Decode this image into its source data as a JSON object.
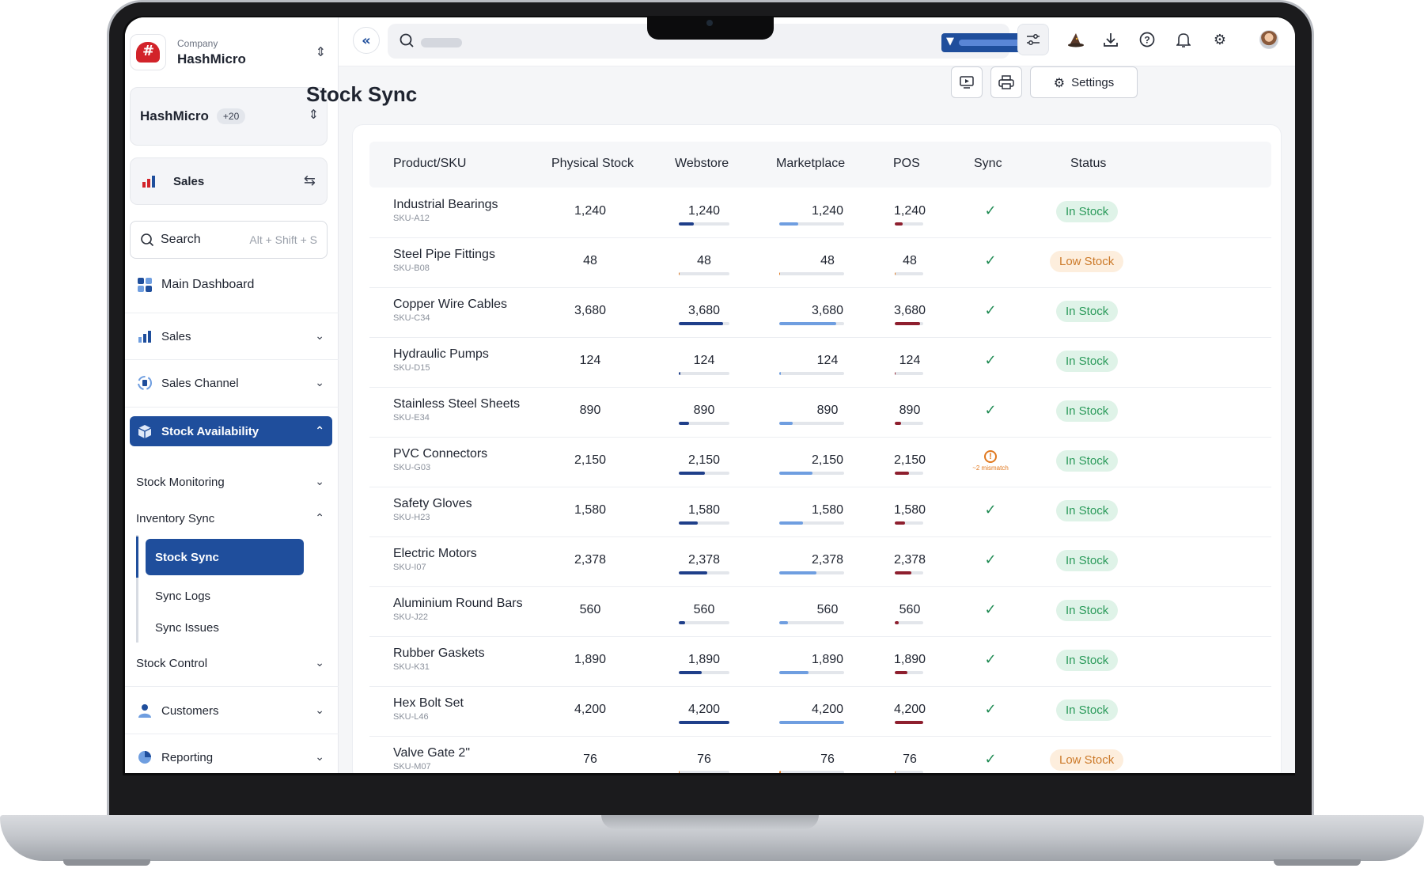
{
  "app": {
    "company_label": "Company",
    "company_name": "HashMicro",
    "switcher_name": "HashMicro",
    "switcher_count": "+20",
    "module_label": "Sales"
  },
  "sidebar": {
    "search_text": "Search",
    "search_hint": "Alt + Shift + S",
    "dashboard": "Main Dashboard",
    "sales": "Sales",
    "sales_channel": "Sales Channel",
    "stock_availability": "Stock Availability",
    "stock_monitoring": "Stock Monitoring",
    "inventory_sync": "Inventory Sync",
    "stock_sync": "Stock Sync",
    "sync_logs": "Sync Logs",
    "sync_issues": "Sync Issues",
    "stock_control": "Stock Control",
    "customers": "Customers",
    "reporting": "Reporting"
  },
  "header": {
    "title": "Stock Sync",
    "settings_label": "Settings"
  },
  "table": {
    "columns": [
      "Product/SKU",
      "Physical Stock",
      "Webstore",
      "Marketplace",
      "POS",
      "Sync",
      "Status"
    ],
    "rows": [
      {
        "name": "Industrial Bearings",
        "sku": "SKU-A12",
        "physical": "1,240",
        "webstore": "1,240",
        "marketplace": "1,240",
        "pos": "1,240",
        "level": 0.29,
        "sync": "ok",
        "status": "In Stock"
      },
      {
        "name": "Steel Pipe Fittings",
        "sku": "SKU-B08",
        "physical": "48",
        "webstore": "48",
        "marketplace": "48",
        "pos": "48",
        "level": 0.01,
        "sync": "ok",
        "status": "Low Stock"
      },
      {
        "name": "Copper Wire Cables",
        "sku": "SKU-C34",
        "physical": "3,680",
        "webstore": "3,680",
        "marketplace": "3,680",
        "pos": "3,680",
        "level": 0.88,
        "sync": "ok",
        "status": "In Stock"
      },
      {
        "name": "Hydraulic Pumps",
        "sku": "SKU-D15",
        "physical": "124",
        "webstore": "124",
        "marketplace": "124",
        "pos": "124",
        "level": 0.03,
        "sync": "ok",
        "status": "In Stock"
      },
      {
        "name": "Stainless Steel Sheets",
        "sku": "SKU-E34",
        "physical": "890",
        "webstore": "890",
        "marketplace": "890",
        "pos": "890",
        "level": 0.21,
        "sync": "ok",
        "status": "In Stock"
      },
      {
        "name": "PVC Connectors",
        "sku": "SKU-G03",
        "physical": "2,150",
        "webstore": "2,150",
        "marketplace": "2,150",
        "pos": "2,150",
        "level": 0.51,
        "sync": "warn",
        "sync_note": "~2 mismatch",
        "status": "In Stock"
      },
      {
        "name": "Safety Gloves",
        "sku": "SKU-H23",
        "physical": "1,580",
        "webstore": "1,580",
        "marketplace": "1,580",
        "pos": "1,580",
        "level": 0.37,
        "sync": "ok",
        "status": "In Stock"
      },
      {
        "name": "Electric Motors",
        "sku": "SKU-I07",
        "physical": "2,378",
        "webstore": "2,378",
        "marketplace": "2,378",
        "pos": "2,378",
        "level": 0.57,
        "sync": "ok",
        "status": "In Stock"
      },
      {
        "name": "Aluminium Round Bars",
        "sku": "SKU-J22",
        "physical": "560",
        "webstore": "560",
        "marketplace": "560",
        "pos": "560",
        "level": 0.13,
        "sync": "ok",
        "status": "In Stock"
      },
      {
        "name": "Rubber Gaskets",
        "sku": "SKU-K31",
        "physical": "1,890",
        "webstore": "1,890",
        "marketplace": "1,890",
        "pos": "1,890",
        "level": 0.45,
        "sync": "ok",
        "status": "In Stock"
      },
      {
        "name": "Hex Bolt Set",
        "sku": "SKU-L46",
        "physical": "4,200",
        "webstore": "4,200",
        "marketplace": "4,200",
        "pos": "4,200",
        "level": 1.0,
        "sync": "ok",
        "status": "In Stock"
      },
      {
        "name": "Valve Gate 2\"",
        "sku": "SKU-M07",
        "physical": "76",
        "webstore": "76",
        "marketplace": "76",
        "pos": "76",
        "level": 0.02,
        "sync": "ok",
        "status": "Low Stock"
      }
    ]
  },
  "colors": {
    "primary": "#1f4e9c",
    "webstore_bar": "#1f3f8a",
    "marketplace_bar": "#6f9ee0",
    "pos_bar": "#8e1f2e",
    "low_bar": "#e0781f",
    "in_stock_text": "#2a9a5a",
    "low_stock_text": "#cc7a2a"
  },
  "icons": [
    "back-chevrons-icon",
    "search-icon",
    "filter-icon",
    "sliders-icon",
    "wizard-hat-icon",
    "download-icon",
    "help-icon",
    "bell-icon",
    "gear-icon",
    "monitor-icon",
    "printer-icon"
  ]
}
